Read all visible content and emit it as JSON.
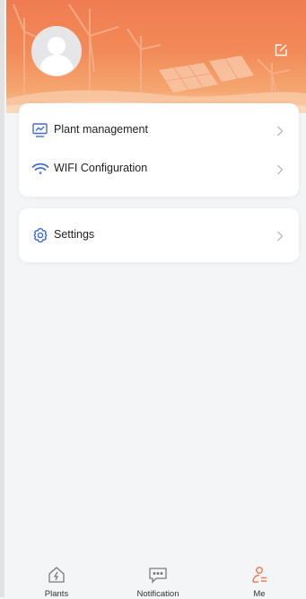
{
  "colors": {
    "accent": "#f07c51",
    "icon_blue": "#3e6fd6",
    "chevron": "#b8b8b8"
  },
  "header": {
    "avatar_icon": "user-avatar-icon",
    "edit_icon": "edit-icon"
  },
  "menu": {
    "group1": [
      {
        "label": "Plant management",
        "icon": "monitor-chart-icon"
      },
      {
        "label": "WIFI Configuration",
        "icon": "wifi-icon"
      }
    ],
    "group2": [
      {
        "label": "Settings",
        "icon": "gear-icon"
      }
    ]
  },
  "tabbar": {
    "tabs": [
      {
        "label": "Plants",
        "icon": "house-bolt-icon"
      },
      {
        "label": "Notification",
        "icon": "chat-bubble-icon"
      },
      {
        "label": "Me",
        "icon": "user-list-icon",
        "active": true
      }
    ]
  }
}
